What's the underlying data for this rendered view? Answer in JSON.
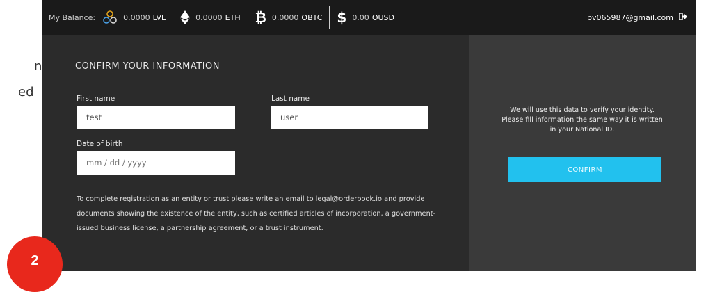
{
  "left_fragment": {
    "line1": "n",
    "line2": "ed"
  },
  "step_badge": {
    "number": "2",
    "color": "#e8281c"
  },
  "header": {
    "balance_label": "My Balance:",
    "balances": [
      {
        "icon": "levels-icon",
        "amount": "0.0000",
        "currency": "LVL"
      },
      {
        "icon": "ethereum-icon",
        "amount": "0.0000",
        "currency": "ETH"
      },
      {
        "icon": "bitcoin-icon",
        "amount": "0.0000",
        "currency": "OBTC"
      },
      {
        "icon": "dollar-icon",
        "amount": "0.00",
        "currency": "OUSD"
      }
    ],
    "email": "pv065987@gmail.com",
    "logout_icon": "sign-out-icon"
  },
  "form": {
    "title": "CONFIRM YOUR INFORMATION",
    "first_name": {
      "label": "First name",
      "value": "test"
    },
    "last_name": {
      "label": "Last name",
      "value": "user"
    },
    "dob": {
      "label": "Date of birth",
      "placeholder": "mm / dd / yyyy"
    },
    "note": "To complete registration as an entity or trust please write an email to legal@orderbook.io and provide documents showing the existence of the entity, such as certified articles of incorporation, a government-issued business license, a partnership agreement, or a trust instrument."
  },
  "side": {
    "info": "We will use this data to verify your identity. Please fill information the same way it is written in your National ID.",
    "confirm_label": "CONFIRM"
  },
  "colors": {
    "accent": "#22c1ee",
    "panel": "#2b2b2b",
    "side_panel": "#3a3a3a",
    "topbar": "#1a1a1a"
  }
}
